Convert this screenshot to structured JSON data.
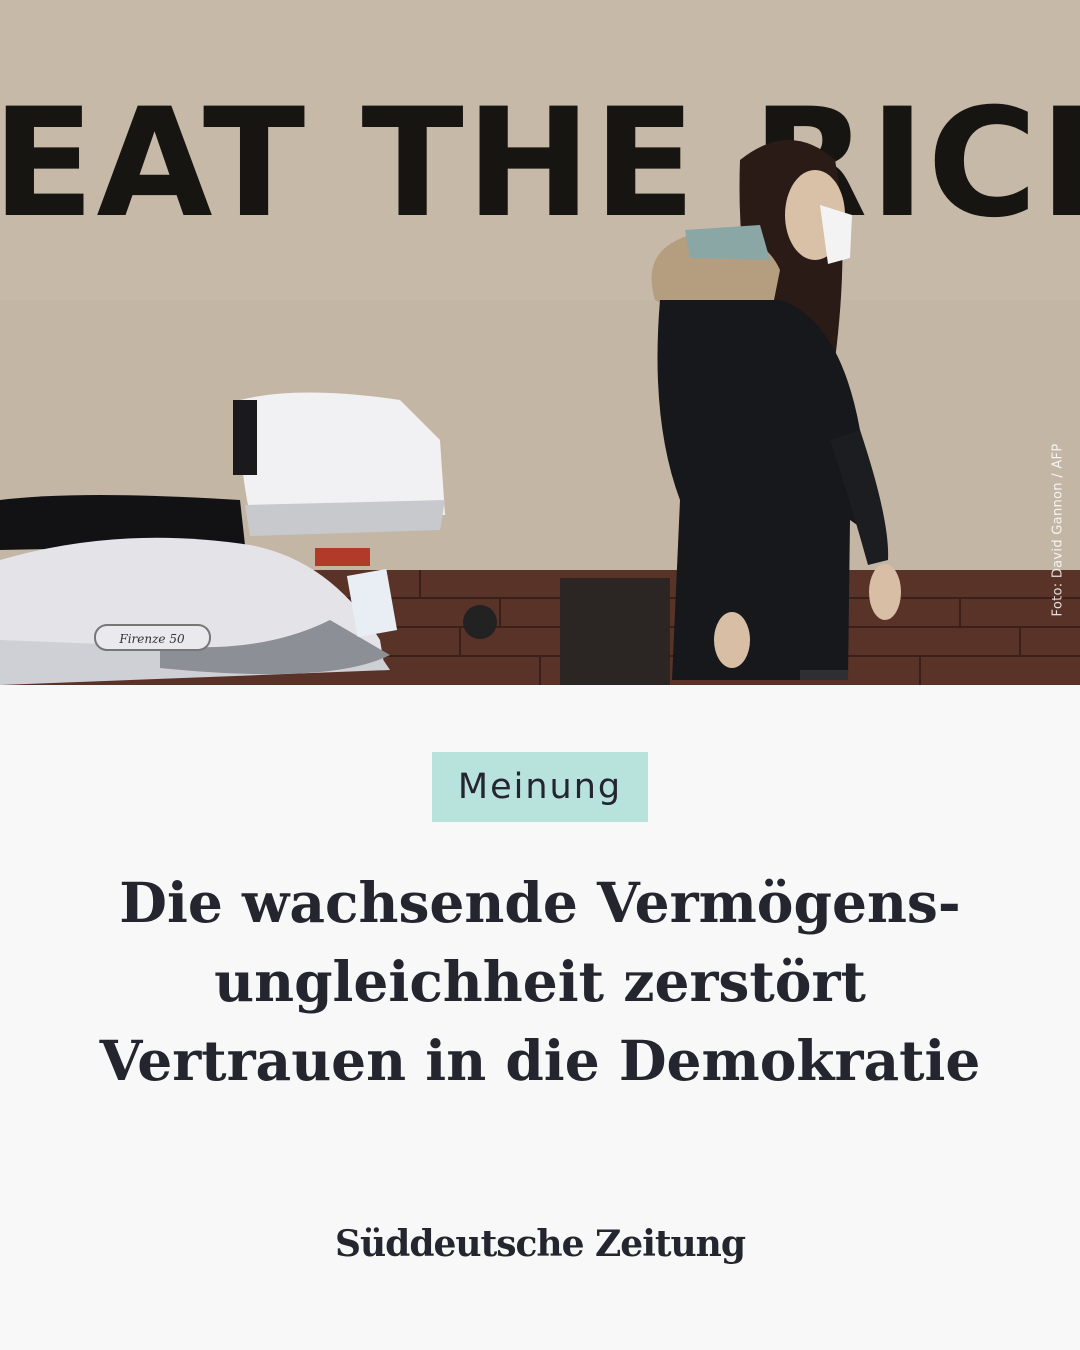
{
  "photo": {
    "graffiti": "EAT THE RICH !",
    "scooter_badge": "Firenze 50",
    "credit": "Foto: David Gannon / AFP"
  },
  "article": {
    "category": "Meinung",
    "headline_lines": [
      "Die wachsende Vermögens-",
      "ungleichheit zerstört",
      "Vertrauen in die Demokratie"
    ]
  },
  "brand": {
    "logo_text": "Süddeutsche Zeitung"
  },
  "colors": {
    "tag_background": "#b8e3dc",
    "text": "#24252f",
    "page_background": "#f8f8f8"
  }
}
